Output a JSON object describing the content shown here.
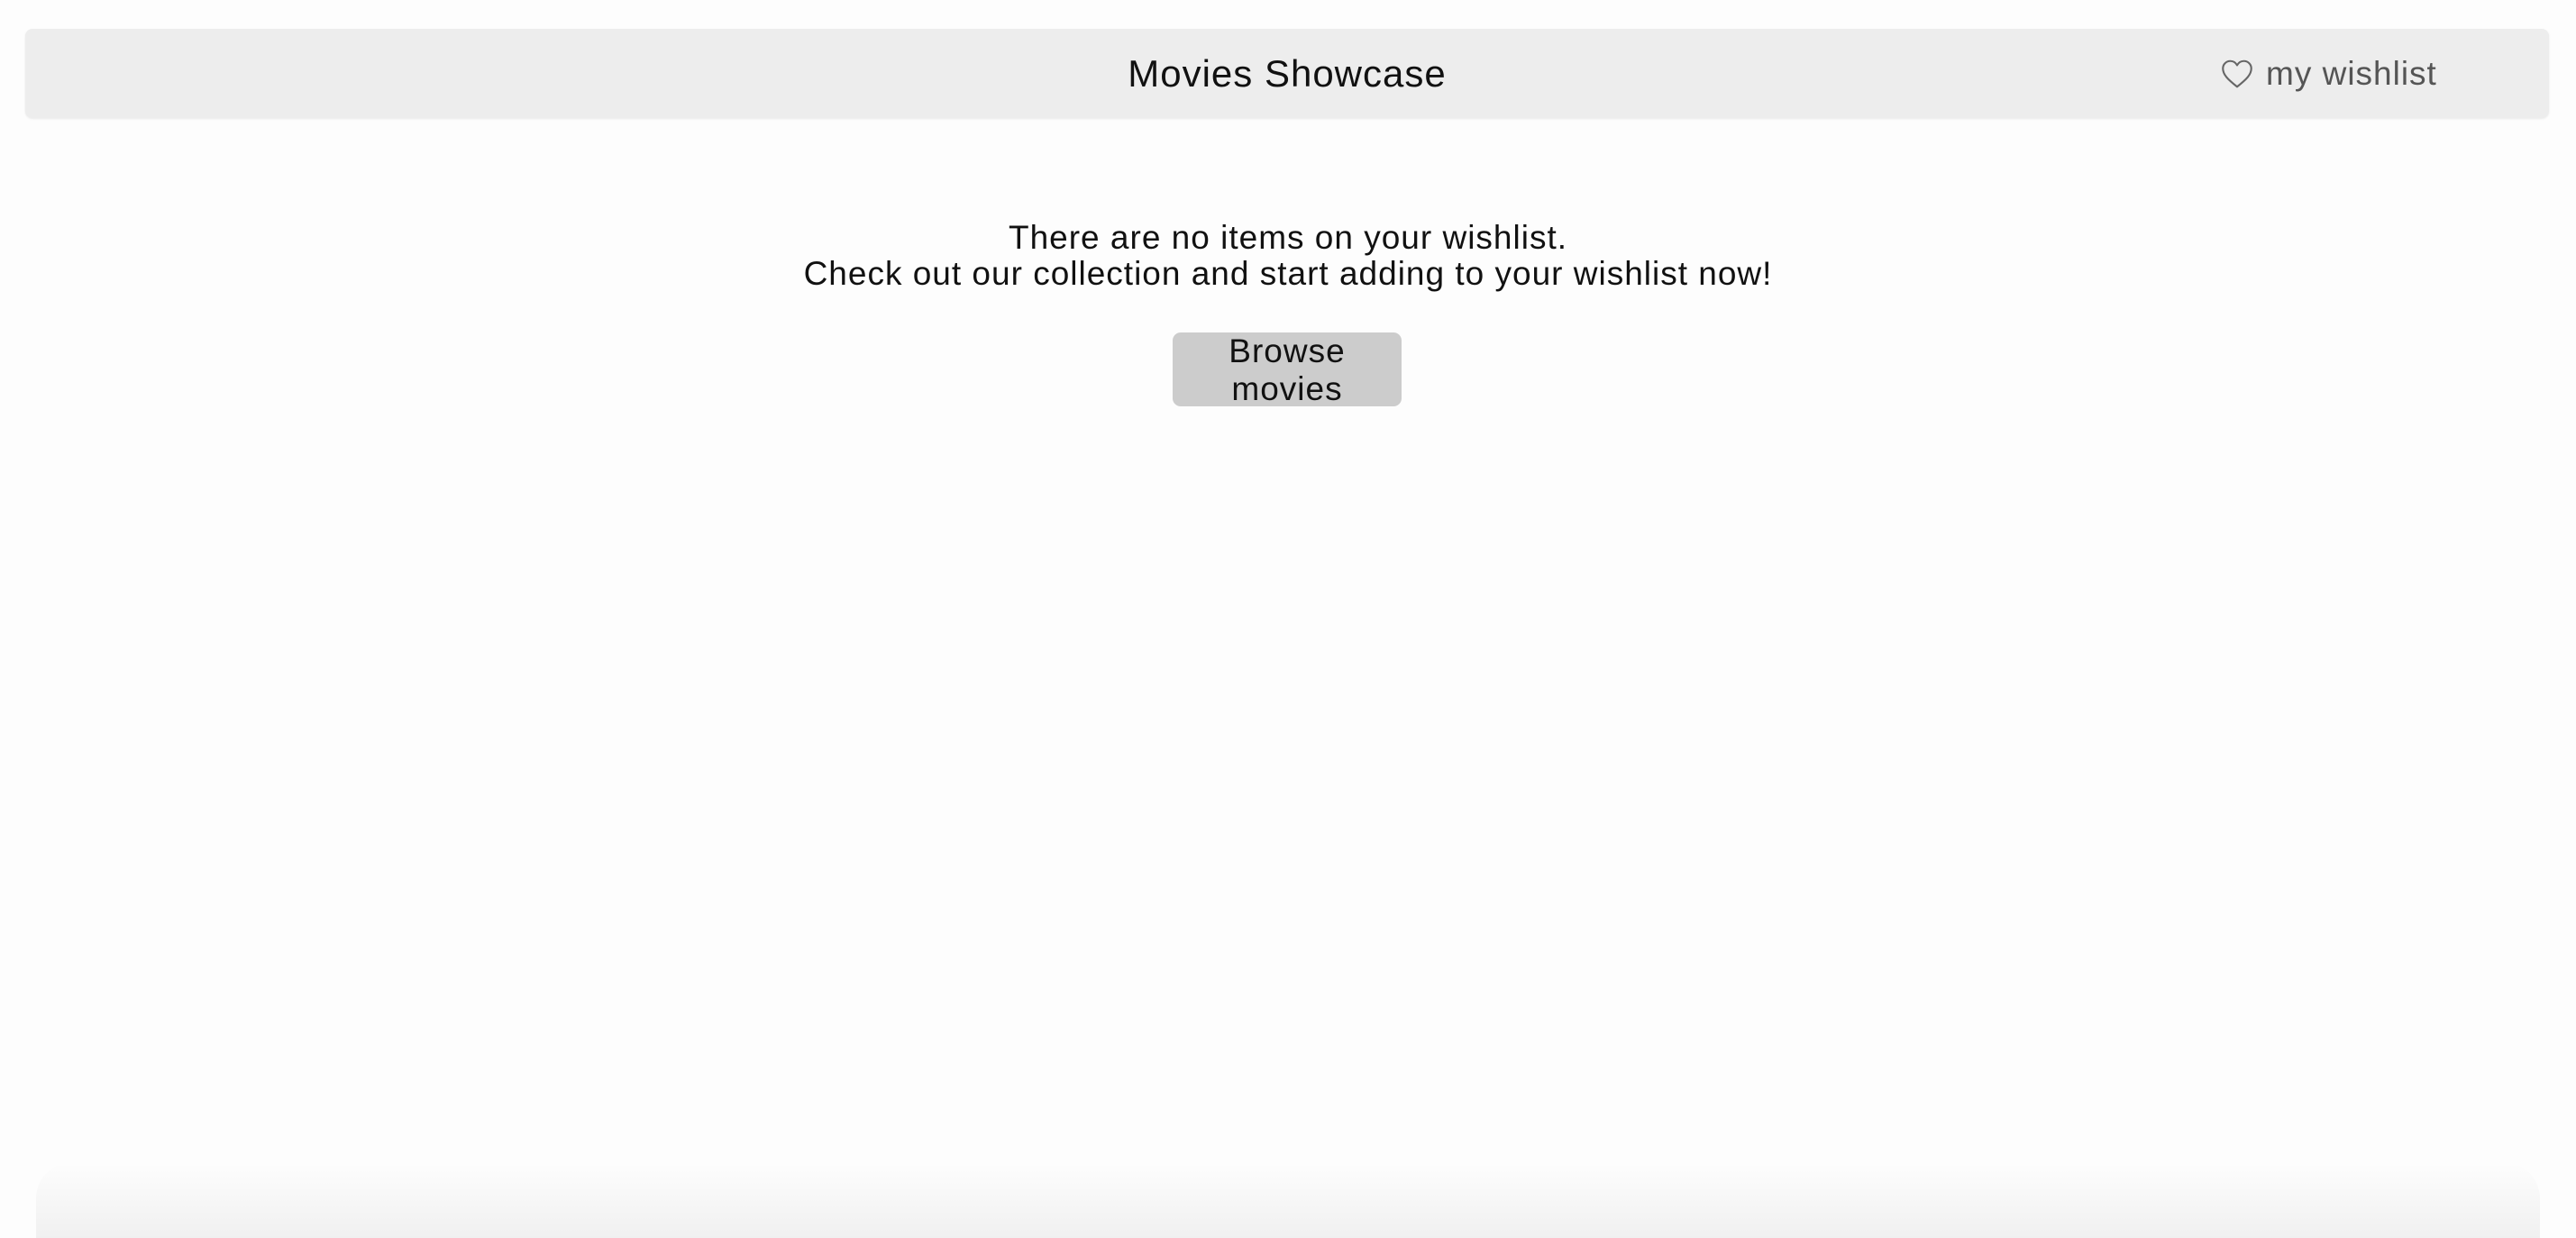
{
  "header": {
    "title": "Movies Showcase",
    "wishlist_label": "my wishlist",
    "wishlist_icon": "heart-outline-icon"
  },
  "empty_state": {
    "line1": "There are no items on your wishlist.",
    "line2": "Check out our collection and start adding to your wishlist now!",
    "button_label": "Browse movies"
  },
  "colors": {
    "header_bg": "#ededed",
    "button_bg": "#cccccc",
    "page_bg": "#fdfdfd"
  }
}
